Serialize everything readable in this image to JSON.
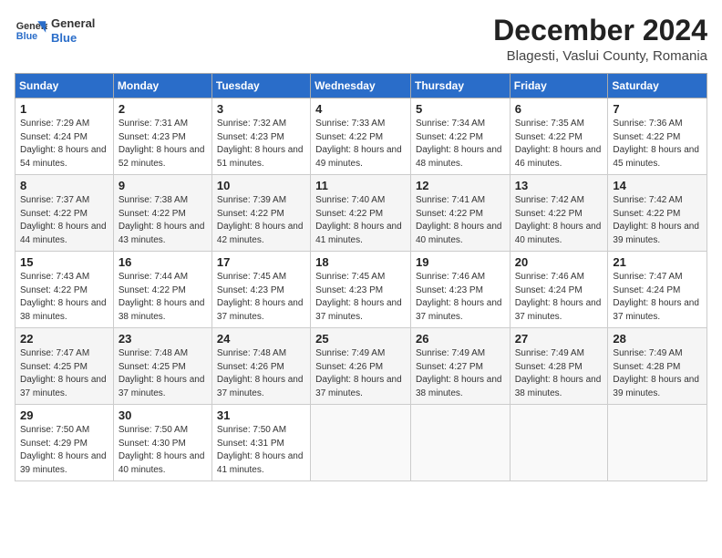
{
  "header": {
    "logo_line1": "General",
    "logo_line2": "Blue",
    "month": "December 2024",
    "location": "Blagesti, Vaslui County, Romania"
  },
  "weekdays": [
    "Sunday",
    "Monday",
    "Tuesday",
    "Wednesday",
    "Thursday",
    "Friday",
    "Saturday"
  ],
  "weeks": [
    [
      {
        "day": 1,
        "rise": "7:29 AM",
        "set": "4:24 PM",
        "daylight": "8 hours and 54 minutes."
      },
      {
        "day": 2,
        "rise": "7:31 AM",
        "set": "4:23 PM",
        "daylight": "8 hours and 52 minutes."
      },
      {
        "day": 3,
        "rise": "7:32 AM",
        "set": "4:23 PM",
        "daylight": "8 hours and 51 minutes."
      },
      {
        "day": 4,
        "rise": "7:33 AM",
        "set": "4:22 PM",
        "daylight": "8 hours and 49 minutes."
      },
      {
        "day": 5,
        "rise": "7:34 AM",
        "set": "4:22 PM",
        "daylight": "8 hours and 48 minutes."
      },
      {
        "day": 6,
        "rise": "7:35 AM",
        "set": "4:22 PM",
        "daylight": "8 hours and 46 minutes."
      },
      {
        "day": 7,
        "rise": "7:36 AM",
        "set": "4:22 PM",
        "daylight": "8 hours and 45 minutes."
      }
    ],
    [
      {
        "day": 8,
        "rise": "7:37 AM",
        "set": "4:22 PM",
        "daylight": "8 hours and 44 minutes."
      },
      {
        "day": 9,
        "rise": "7:38 AM",
        "set": "4:22 PM",
        "daylight": "8 hours and 43 minutes."
      },
      {
        "day": 10,
        "rise": "7:39 AM",
        "set": "4:22 PM",
        "daylight": "8 hours and 42 minutes."
      },
      {
        "day": 11,
        "rise": "7:40 AM",
        "set": "4:22 PM",
        "daylight": "8 hours and 41 minutes."
      },
      {
        "day": 12,
        "rise": "7:41 AM",
        "set": "4:22 PM",
        "daylight": "8 hours and 40 minutes."
      },
      {
        "day": 13,
        "rise": "7:42 AM",
        "set": "4:22 PM",
        "daylight": "8 hours and 40 minutes."
      },
      {
        "day": 14,
        "rise": "7:42 AM",
        "set": "4:22 PM",
        "daylight": "8 hours and 39 minutes."
      }
    ],
    [
      {
        "day": 15,
        "rise": "7:43 AM",
        "set": "4:22 PM",
        "daylight": "8 hours and 38 minutes."
      },
      {
        "day": 16,
        "rise": "7:44 AM",
        "set": "4:22 PM",
        "daylight": "8 hours and 38 minutes."
      },
      {
        "day": 17,
        "rise": "7:45 AM",
        "set": "4:23 PM",
        "daylight": "8 hours and 37 minutes."
      },
      {
        "day": 18,
        "rise": "7:45 AM",
        "set": "4:23 PM",
        "daylight": "8 hours and 37 minutes."
      },
      {
        "day": 19,
        "rise": "7:46 AM",
        "set": "4:23 PM",
        "daylight": "8 hours and 37 minutes."
      },
      {
        "day": 20,
        "rise": "7:46 AM",
        "set": "4:24 PM",
        "daylight": "8 hours and 37 minutes."
      },
      {
        "day": 21,
        "rise": "7:47 AM",
        "set": "4:24 PM",
        "daylight": "8 hours and 37 minutes."
      }
    ],
    [
      {
        "day": 22,
        "rise": "7:47 AM",
        "set": "4:25 PM",
        "daylight": "8 hours and 37 minutes."
      },
      {
        "day": 23,
        "rise": "7:48 AM",
        "set": "4:25 PM",
        "daylight": "8 hours and 37 minutes."
      },
      {
        "day": 24,
        "rise": "7:48 AM",
        "set": "4:26 PM",
        "daylight": "8 hours and 37 minutes."
      },
      {
        "day": 25,
        "rise": "7:49 AM",
        "set": "4:26 PM",
        "daylight": "8 hours and 37 minutes."
      },
      {
        "day": 26,
        "rise": "7:49 AM",
        "set": "4:27 PM",
        "daylight": "8 hours and 38 minutes."
      },
      {
        "day": 27,
        "rise": "7:49 AM",
        "set": "4:28 PM",
        "daylight": "8 hours and 38 minutes."
      },
      {
        "day": 28,
        "rise": "7:49 AM",
        "set": "4:28 PM",
        "daylight": "8 hours and 39 minutes."
      }
    ],
    [
      {
        "day": 29,
        "rise": "7:50 AM",
        "set": "4:29 PM",
        "daylight": "8 hours and 39 minutes."
      },
      {
        "day": 30,
        "rise": "7:50 AM",
        "set": "4:30 PM",
        "daylight": "8 hours and 40 minutes."
      },
      {
        "day": 31,
        "rise": "7:50 AM",
        "set": "4:31 PM",
        "daylight": "8 hours and 41 minutes."
      },
      null,
      null,
      null,
      null
    ]
  ],
  "colors": {
    "header_bg": "#2a6dc9",
    "header_text": "#ffffff"
  }
}
